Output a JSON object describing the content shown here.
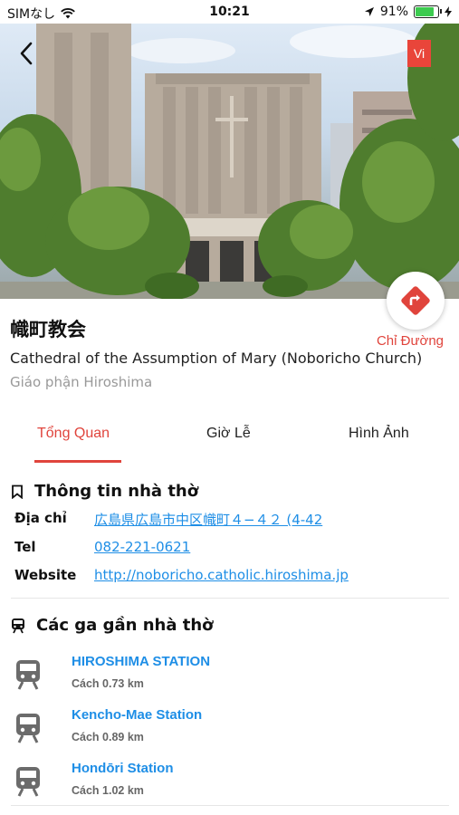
{
  "status_bar": {
    "carrier": "SIMなし",
    "time": "10:21",
    "battery": "91%",
    "battery_level": 0.91
  },
  "header": {
    "language_badge": "Vi"
  },
  "church": {
    "name": "幟町教会",
    "english_name": "Cathedral of the Assumption of Mary (Noboricho Church)",
    "diocese": "Giáo phận Hiroshima",
    "direction_label": "Chỉ Đường"
  },
  "tabs": [
    {
      "label": "Tổng Quan",
      "active": true
    },
    {
      "label": "Giờ Lễ",
      "active": false
    },
    {
      "label": "Hình Ảnh",
      "active": false
    }
  ],
  "info": {
    "heading": "Thông tin nhà thờ",
    "rows": [
      {
        "label": "Địa chỉ",
        "value": "広島県広島市中区幟町４−４２ (4-42"
      },
      {
        "label": "Tel",
        "value": "082-221-0621"
      },
      {
        "label": "Website",
        "value": "http://noboricho.catholic.hiroshima.jp"
      }
    ]
  },
  "stations": {
    "heading": "Các ga gần nhà thờ",
    "items": [
      {
        "name": "HIROSHIMA STATION",
        "distance": "Cách 0.73 km"
      },
      {
        "name": "Kencho-Mae Station",
        "distance": "Cách 0.89 km"
      },
      {
        "name": "Hondōri Station",
        "distance": "Cách 1.02 km"
      }
    ]
  }
}
